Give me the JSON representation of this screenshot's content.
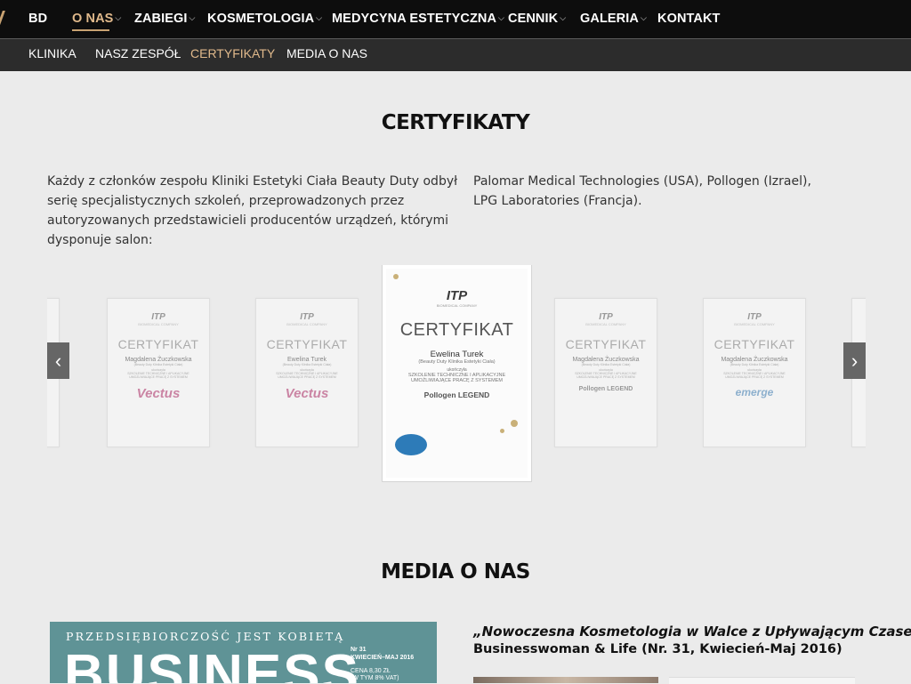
{
  "top_nav": {
    "items": [
      {
        "label": "BD",
        "active": false,
        "dropdown": false
      },
      {
        "label": "O NAS",
        "active": true,
        "dropdown": true
      },
      {
        "label": "ZABIEGI",
        "active": false,
        "dropdown": true
      },
      {
        "label": "KOSMETOLOGIA",
        "active": false,
        "dropdown": true
      },
      {
        "label": "MEDYCYNA ESTETYCZNA",
        "active": false,
        "dropdown": true
      },
      {
        "label": "CENNIK",
        "active": false,
        "dropdown": true
      },
      {
        "label": "GALERIA",
        "active": false,
        "dropdown": true
      },
      {
        "label": "KONTAKT",
        "active": false,
        "dropdown": false
      }
    ]
  },
  "sub_nav": {
    "items": [
      {
        "label": "KLINIKA",
        "active": false
      },
      {
        "label": "NASZ ZESPÓŁ",
        "active": false
      },
      {
        "label": "CERTYFIKATY",
        "active": true
      },
      {
        "label": "MEDIA O NAS",
        "active": false
      }
    ]
  },
  "certificates_section": {
    "heading": "CERTYFIKATY",
    "intro_left": [
      "Każdy z członków zespołu Kliniki Estetyki Ciała Beauty Duty odbył",
      "serię specjalistycznych szkoleń, przeprowadzonych przez",
      "autoryzowanych przedstawicieli producentów urządzeń, którymi",
      "dysponuje salon:"
    ],
    "intro_right": [
      "Palomar Medical Technologies (USA), Pollogen (Izrael),",
      "LPG Laboratories (Francja)."
    ]
  },
  "carousel": {
    "prev_icon": "chevron-left-icon",
    "next_icon": "chevron-right-icon",
    "slides": [
      {
        "logo": "ITP",
        "logo_sub": "BIOMEDICAL COMPANY",
        "title": "CERTYFIKAT",
        "name": "Magdalena Żuczkowska",
        "clinic": "(Beauty Duty Klinika Estetyki Ciała)",
        "completed": "ukończyła",
        "training": "SZKOLENIE TECHNICZNE I APLIKACYJNE UMOŻLIWIAJĄCE PRACĘ Z SYSTEMEM",
        "brand": "Vectus",
        "brand_color": "#b0306a",
        "featured": false
      },
      {
        "logo": "ITP",
        "logo_sub": "BIOMEDICAL COMPANY",
        "title": "CERTYFIKAT",
        "name": "Ewelina Turek",
        "clinic": "(Beauty Duty Klinika Estetyki Ciała)",
        "completed": "ukończyła",
        "training": "SZKOLENIE TECHNICZNE I APLIKACYJNE UMOŻLIWIAJĄCE PRACĘ Z SYSTEMEM",
        "brand": "Vectus",
        "brand_color": "#b0306a",
        "featured": false
      },
      {
        "logo": "ITP",
        "logo_sub": "BIOMEDICAL COMPANY",
        "title": "CERTYFIKAT",
        "name": "Ewelina Turek",
        "clinic": "(Beauty Duty Klinika Estetyki Ciała)",
        "completed": "ukończyła",
        "training": "SZKOLENIE TECHNICZNE I APLIKACYJNE UMOŻLIWIAJĄCE PRACĘ Z SYSTEMEM",
        "brand": "Pollogen LEGEND",
        "brand_color": "#555555",
        "featured": true
      },
      {
        "logo": "ITP",
        "logo_sub": "BIOMEDICAL COMPANY",
        "title": "CERTYFIKAT",
        "name": "Magdalena Żuczkowska",
        "clinic": "(Beauty Duty Klinika Estetyki Ciała)",
        "completed": "ukończyła",
        "training": "SZKOLENIE TECHNICZNE I APLIKACYJNE UMOŻLIWIAJĄCE PRACĘ Z SYSTEMEM",
        "brand": "Pollogen LEGEND",
        "brand_color": "#555555",
        "featured": false
      },
      {
        "logo": "ITP",
        "logo_sub": "BIOMEDICAL COMPANY",
        "title": "CERTYFIKAT",
        "name": "Magdalena Żuczkowska",
        "clinic": "(Beauty Duty Klinika Estetyki Ciała)",
        "completed": "ukończyła",
        "training": "SZKOLENIE TECHNICZNE I APLIKACYJNE UMOŻLIWIAJĄCE PRACĘ Z SYSTEMEM",
        "brand": "emerge",
        "brand_color": "#3f7fb6",
        "featured": false
      }
    ]
  },
  "media_section": {
    "heading": "MEDIA O NAS",
    "magazine": {
      "tagline": "PRZEDSIĘBIORCZOŚĆ JEST KOBIETĄ",
      "title": "BUSINESS",
      "issue_number": "Nr 31",
      "issue_date": "KWIECIEŃ–MAJ 2016",
      "price": "CENA 8,30 ZŁ",
      "vat": "(W TYM 8% VAT)",
      "color": "#5f9396"
    },
    "article_title": "„Nowoczesna Kosmetologia w Walce z Upływającym Czasem”",
    "article_source": "Businesswoman & Life (Nr. 31, Kwiecień-Maj 2016)"
  }
}
